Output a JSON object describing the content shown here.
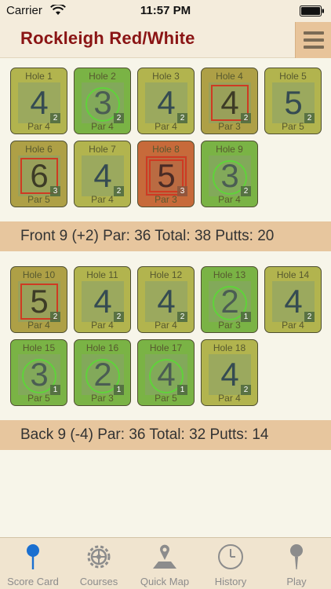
{
  "status_bar": {
    "carrier": "Carrier",
    "time": "11:57 PM"
  },
  "header": {
    "course_name": "Rockleigh Red/White",
    "menu_icon": "hamburger-menu-icon"
  },
  "front_nine": [
    {
      "hole": "Hole 1",
      "score": "4",
      "putts": "2",
      "par": "Par 4",
      "result": "par",
      "mark": "none"
    },
    {
      "hole": "Hole 2",
      "score": "3",
      "putts": "2",
      "par": "Par 4",
      "result": "birdie",
      "mark": "circle"
    },
    {
      "hole": "Hole 3",
      "score": "4",
      "putts": "2",
      "par": "Par 4",
      "result": "par",
      "mark": "none"
    },
    {
      "hole": "Hole 4",
      "score": "4",
      "putts": "2",
      "par": "Par 3",
      "result": "bogey",
      "mark": "square"
    },
    {
      "hole": "Hole 5",
      "score": "5",
      "putts": "2",
      "par": "Par 5",
      "result": "par",
      "mark": "none"
    },
    {
      "hole": "Hole 6",
      "score": "6",
      "putts": "3",
      "par": "Par 5",
      "result": "bogey",
      "mark": "square"
    },
    {
      "hole": "Hole 7",
      "score": "4",
      "putts": "2",
      "par": "Par 4",
      "result": "par",
      "mark": "none"
    },
    {
      "hole": "Hole 8",
      "score": "5",
      "putts": "3",
      "par": "Par 3",
      "result": "double-bogey",
      "mark": "double-square"
    },
    {
      "hole": "Hole 9",
      "score": "3",
      "putts": "2",
      "par": "Par 4",
      "result": "birdie",
      "mark": "circle"
    }
  ],
  "front_summary": "Front 9 (+2) Par: 36 Total: 38 Putts: 20",
  "back_nine": [
    {
      "hole": "Hole 10",
      "score": "5",
      "putts": "2",
      "par": "Par 4",
      "result": "bogey",
      "mark": "square"
    },
    {
      "hole": "Hole 11",
      "score": "4",
      "putts": "2",
      "par": "Par 4",
      "result": "par",
      "mark": "none"
    },
    {
      "hole": "Hole 12",
      "score": "4",
      "putts": "2",
      "par": "Par 4",
      "result": "par",
      "mark": "none"
    },
    {
      "hole": "Hole 13",
      "score": "2",
      "putts": "1",
      "par": "Par 3",
      "result": "birdie",
      "mark": "circle"
    },
    {
      "hole": "Hole 14",
      "score": "4",
      "putts": "2",
      "par": "Par 4",
      "result": "par",
      "mark": "none"
    },
    {
      "hole": "Hole 15",
      "score": "3",
      "putts": "1",
      "par": "Par 5",
      "result": "birdie",
      "mark": "circle"
    },
    {
      "hole": "Hole 16",
      "score": "2",
      "putts": "1",
      "par": "Par 3",
      "result": "birdie",
      "mark": "circle"
    },
    {
      "hole": "Hole 17",
      "score": "4",
      "putts": "1",
      "par": "Par 5",
      "result": "birdie",
      "mark": "circle"
    },
    {
      "hole": "Hole 18",
      "score": "4",
      "putts": "2",
      "par": "Par 4",
      "result": "par",
      "mark": "none"
    }
  ],
  "back_summary": "Back 9 (-4) Par: 36 Total: 32 Putts: 14",
  "tabs": [
    {
      "label": "Score Card",
      "icon": "pin-icon",
      "selected": true
    },
    {
      "label": "Courses",
      "icon": "gear-icon",
      "selected": false
    },
    {
      "label": "Quick Map",
      "icon": "map-pin-icon",
      "selected": false
    },
    {
      "label": "History",
      "icon": "clock-icon",
      "selected": false
    },
    {
      "label": "Play",
      "icon": "golf-tee-icon",
      "selected": false
    }
  ],
  "colors": {
    "title": "#8a1414",
    "par_tile": "#b2b44e",
    "bogey_tile": "#aea046",
    "double_bogey_tile": "#c76a3a",
    "birdie_tile": "#7ab345",
    "birdie_mark": "#5fd33a",
    "bogey_mark": "#cf3a22",
    "summary_band": "#e7c69e",
    "active_tab": "#1a6fd0"
  }
}
